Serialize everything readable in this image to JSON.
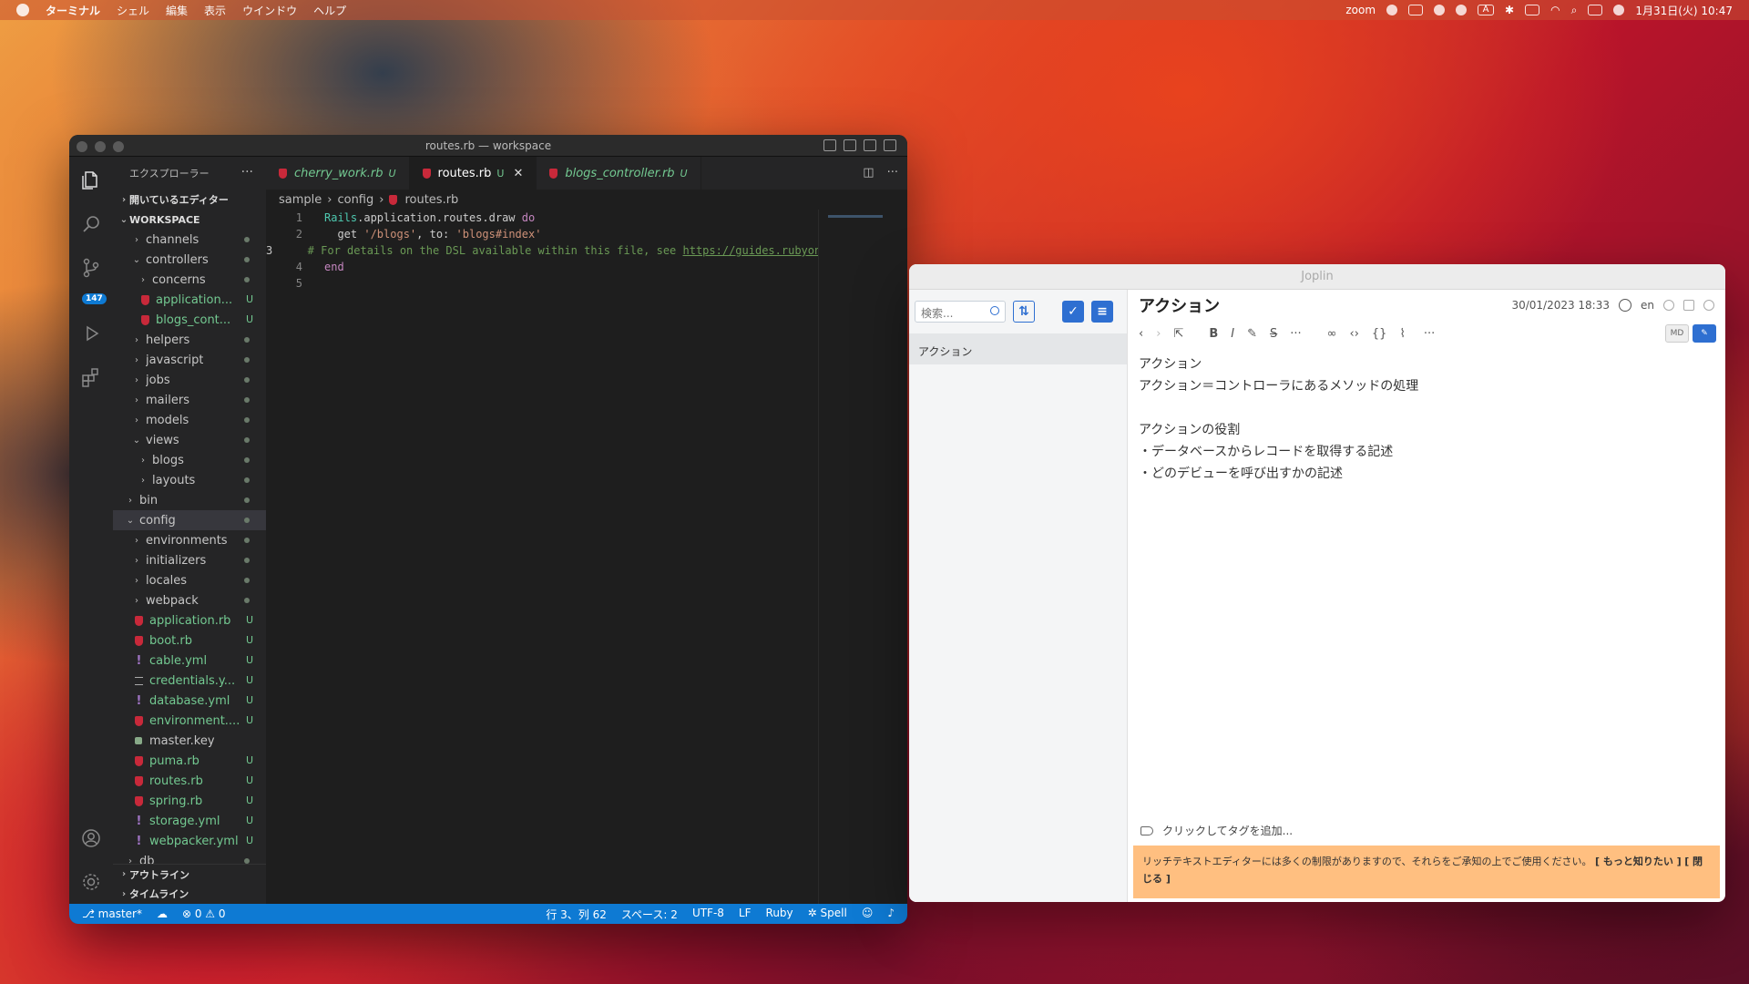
{
  "menubar": {
    "app": "ターミナル",
    "items": [
      "シェル",
      "編集",
      "表示",
      "ウインドウ",
      "ヘルプ"
    ],
    "zoom": "zoom",
    "input_mode": "A",
    "clock": "1月31日(火) 10:47"
  },
  "vscode": {
    "window_title": "routes.rb — workspace",
    "explorer_title": "エクスプローラー",
    "open_editors": "開いているエディター",
    "workspace": "WORKSPACE",
    "scm_badge": "147",
    "tree": [
      {
        "label": "channels",
        "depth": 2,
        "type": "folder",
        "chev": "›",
        "mark": "dot"
      },
      {
        "label": "controllers",
        "depth": 2,
        "type": "folder",
        "chev": "⌄",
        "mark": "dot"
      },
      {
        "label": "concerns",
        "depth": 3,
        "type": "folder",
        "chev": "›",
        "mark": "dot"
      },
      {
        "label": "application...",
        "depth": 3,
        "type": "ruby",
        "mark": "U"
      },
      {
        "label": "blogs_cont...",
        "depth": 3,
        "type": "ruby",
        "mark": "U"
      },
      {
        "label": "helpers",
        "depth": 2,
        "type": "folder",
        "chev": "›",
        "mark": "dot"
      },
      {
        "label": "javascript",
        "depth": 2,
        "type": "folder",
        "chev": "›",
        "mark": "dot"
      },
      {
        "label": "jobs",
        "depth": 2,
        "type": "folder",
        "chev": "›",
        "mark": "dot"
      },
      {
        "label": "mailers",
        "depth": 2,
        "type": "folder",
        "chev": "›",
        "mark": "dot"
      },
      {
        "label": "models",
        "depth": 2,
        "type": "folder",
        "chev": "›",
        "mark": "dot"
      },
      {
        "label": "views",
        "depth": 2,
        "type": "folder",
        "chev": "⌄",
        "mark": "dot"
      },
      {
        "label": "blogs",
        "depth": 3,
        "type": "folder",
        "chev": "›",
        "mark": "dot"
      },
      {
        "label": "layouts",
        "depth": 3,
        "type": "folder",
        "chev": "›",
        "mark": "dot"
      },
      {
        "label": "bin",
        "depth": 1,
        "type": "folder",
        "chev": "›",
        "mark": "dot"
      },
      {
        "label": "config",
        "depth": 1,
        "type": "folder",
        "chev": "⌄",
        "mark": "dot",
        "selected": true
      },
      {
        "label": "environments",
        "depth": 2,
        "type": "folder",
        "chev": "›",
        "mark": "dot"
      },
      {
        "label": "initializers",
        "depth": 2,
        "type": "folder",
        "chev": "›",
        "mark": "dot"
      },
      {
        "label": "locales",
        "depth": 2,
        "type": "folder",
        "chev": "›",
        "mark": "dot"
      },
      {
        "label": "webpack",
        "depth": 2,
        "type": "folder",
        "chev": "›",
        "mark": "dot"
      },
      {
        "label": "application.rb",
        "depth": 2,
        "type": "ruby",
        "mark": "U"
      },
      {
        "label": "boot.rb",
        "depth": 2,
        "type": "ruby",
        "mark": "U"
      },
      {
        "label": "cable.yml",
        "depth": 2,
        "type": "yml",
        "mark": "U"
      },
      {
        "label": "credentials.y...",
        "depth": 2,
        "type": "lines",
        "mark": "U"
      },
      {
        "label": "database.yml",
        "depth": 2,
        "type": "yml",
        "mark": "U"
      },
      {
        "label": "environment....",
        "depth": 2,
        "type": "ruby",
        "mark": "U"
      },
      {
        "label": "master.key",
        "depth": 2,
        "type": "lock",
        "mark": ""
      },
      {
        "label": "puma.rb",
        "depth": 2,
        "type": "ruby",
        "mark": "U"
      },
      {
        "label": "routes.rb",
        "depth": 2,
        "type": "ruby",
        "mark": "U"
      },
      {
        "label": "spring.rb",
        "depth": 2,
        "type": "ruby",
        "mark": "U"
      },
      {
        "label": "storage.yml",
        "depth": 2,
        "type": "yml",
        "mark": "U"
      },
      {
        "label": "webpacker.yml",
        "depth": 2,
        "type": "yml",
        "mark": "U"
      },
      {
        "label": "db",
        "depth": 1,
        "type": "folder",
        "chev": "›",
        "mark": "dot"
      }
    ],
    "outline": "アウトライン",
    "timeline": "タイムライン",
    "tabs": [
      {
        "name": "cherry_work.rb",
        "mark": "U",
        "italic": true
      },
      {
        "name": "routes.rb",
        "mark": "U",
        "active": true
      },
      {
        "name": "blogs_controller.rb",
        "mark": "U",
        "italic": true
      }
    ],
    "breadcrumb": [
      "sample",
      "config",
      "routes.rb"
    ],
    "code": [
      {
        "n": "1",
        "parts": [
          [
            "cls",
            "Rails"
          ],
          [
            "",
            ".application.routes.draw "
          ],
          [
            "k",
            "do"
          ]
        ]
      },
      {
        "n": "2",
        "parts": [
          [
            "",
            "  get "
          ],
          [
            "s",
            "'/blogs'"
          ],
          [
            "",
            ", to: "
          ],
          [
            "s",
            "'blogs#index'"
          ]
        ]
      },
      {
        "n": "3",
        "cur": true,
        "parts": [
          [
            "c",
            "  # For details on the DSL available within this file, see "
          ],
          [
            "cu",
            "https://guides.rubyonrails.org/routing.html"
          ]
        ]
      },
      {
        "n": "4",
        "parts": [
          [
            "k",
            "end"
          ]
        ]
      },
      {
        "n": "5",
        "parts": []
      }
    ],
    "status": {
      "branch": "master*",
      "problems": "⊗ 0 ⚠ 0",
      "position": "行 3、列 62",
      "spaces": "スペース: 2",
      "encoding": "UTF-8",
      "eol": "LF",
      "language": "Ruby",
      "spell": "Spell"
    }
  },
  "joplin": {
    "window_title": "Joplin",
    "search_placeholder": "検索...",
    "note_list": [
      "アクション"
    ],
    "note_title": "アクション",
    "date": "30/01/2023 18:33",
    "lang": "en",
    "body": [
      "アクション",
      "アクション＝コントローラにあるメソッドの処理",
      "",
      "アクションの役割",
      "・データベースからレコードを取得する記述",
      "・どのデビューを呼び出すかの記述"
    ],
    "tag_prompt": "クリックしてタグを追加...",
    "banner_text": "リッチテキストエディターには多くの制限がありますので、それらをご承知の上でご使用ください。",
    "banner_more": "[ もっと知りたい ]",
    "banner_close": "[ 閉じる ]",
    "toolbar_md": "MD"
  }
}
